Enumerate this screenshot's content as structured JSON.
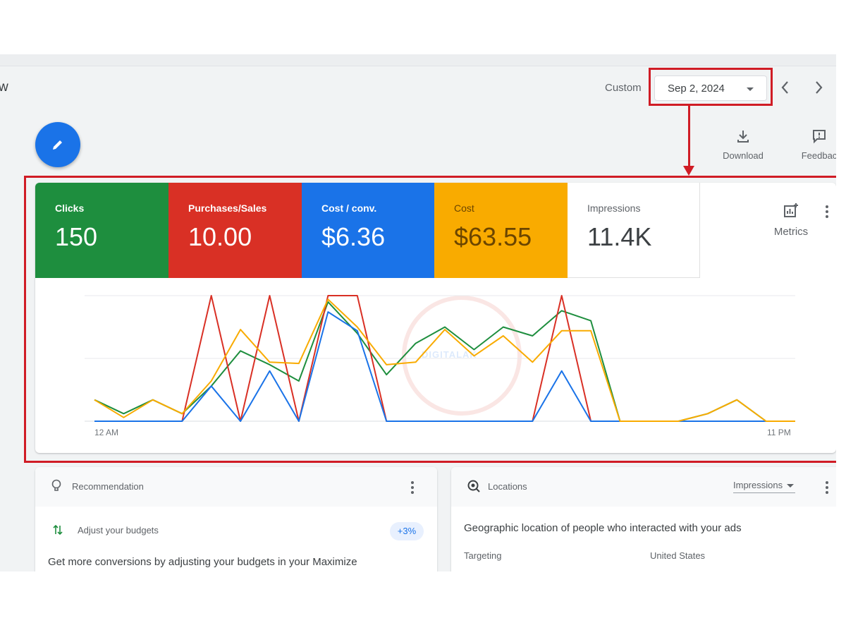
{
  "header": {
    "title_fragment": "w",
    "range_label": "Custom",
    "date_value": "Sep 2, 2024",
    "actions": [
      {
        "label": "Download",
        "icon": "download-icon"
      },
      {
        "label": "Feedbac",
        "icon": "feedback-icon"
      }
    ]
  },
  "metrics": {
    "tiles": [
      {
        "label": "Clicks",
        "value": "150",
        "color": "#1e8e3e"
      },
      {
        "label": "Purchases/Sales",
        "value": "10.00",
        "color": "#d93025"
      },
      {
        "label": "Cost / conv.",
        "value": "$6.36",
        "color": "#1a73e8"
      },
      {
        "label": "Cost",
        "value": "$63.55",
        "color": "#f9ab00"
      },
      {
        "label": "Impressions",
        "value": "11.4K",
        "color": "#ffffff"
      }
    ],
    "metrics_button": "Metrics"
  },
  "chart_data": {
    "type": "line",
    "xlabel": "",
    "ylabel": "",
    "x_tick_labels": [
      "12 AM",
      "11 PM"
    ],
    "x": [
      "12 AM",
      "1",
      "2",
      "3",
      "4",
      "5",
      "6",
      "7",
      "8",
      "9",
      "10",
      "11",
      "12",
      "13",
      "14",
      "15",
      "16",
      "17",
      "18",
      "19",
      "20",
      "21",
      "22",
      "23",
      "11 PM"
    ],
    "ylim": [
      0,
      100
    ],
    "grid": true,
    "series": [
      {
        "color": "#1e8e3e",
        "values": [
          17,
          6,
          17,
          6,
          28,
          56,
          45,
          32,
          95,
          70,
          37,
          62,
          75,
          57,
          75,
          68,
          88,
          80,
          0,
          0,
          0,
          6,
          17,
          0,
          0
        ]
      },
      {
        "color": "#d93025",
        "values": [
          0,
          0,
          0,
          0,
          100,
          0,
          100,
          0,
          100,
          100,
          0,
          0,
          0,
          0,
          0,
          0,
          100,
          0,
          0,
          0,
          0,
          0,
          0,
          0,
          0
        ]
      },
      {
        "color": "#1a73e8",
        "values": [
          0,
          0,
          0,
          0,
          28,
          0,
          40,
          0,
          87,
          72,
          0,
          0,
          0,
          0,
          0,
          0,
          40,
          0,
          0,
          0,
          0,
          0,
          0,
          0,
          0
        ]
      },
      {
        "color": "#f9ab00",
        "values": [
          17,
          3,
          17,
          6,
          32,
          73,
          47,
          46,
          97,
          75,
          45,
          47,
          73,
          52,
          68,
          47,
          72,
          72,
          0,
          0,
          0,
          6,
          17,
          0,
          0
        ]
      }
    ]
  },
  "recommendation": {
    "title": "Recommendation",
    "item": "Adjust your budgets",
    "badge": "+3%",
    "text": "Get more conversions by adjusting your budgets in your Maximize"
  },
  "locations": {
    "title": "Locations",
    "metric_select": "Impressions",
    "heading": "Geographic location of people who interacted with your ads",
    "row_label": "Targeting",
    "row_value": "United States"
  },
  "watermark": "DIGITALAK"
}
